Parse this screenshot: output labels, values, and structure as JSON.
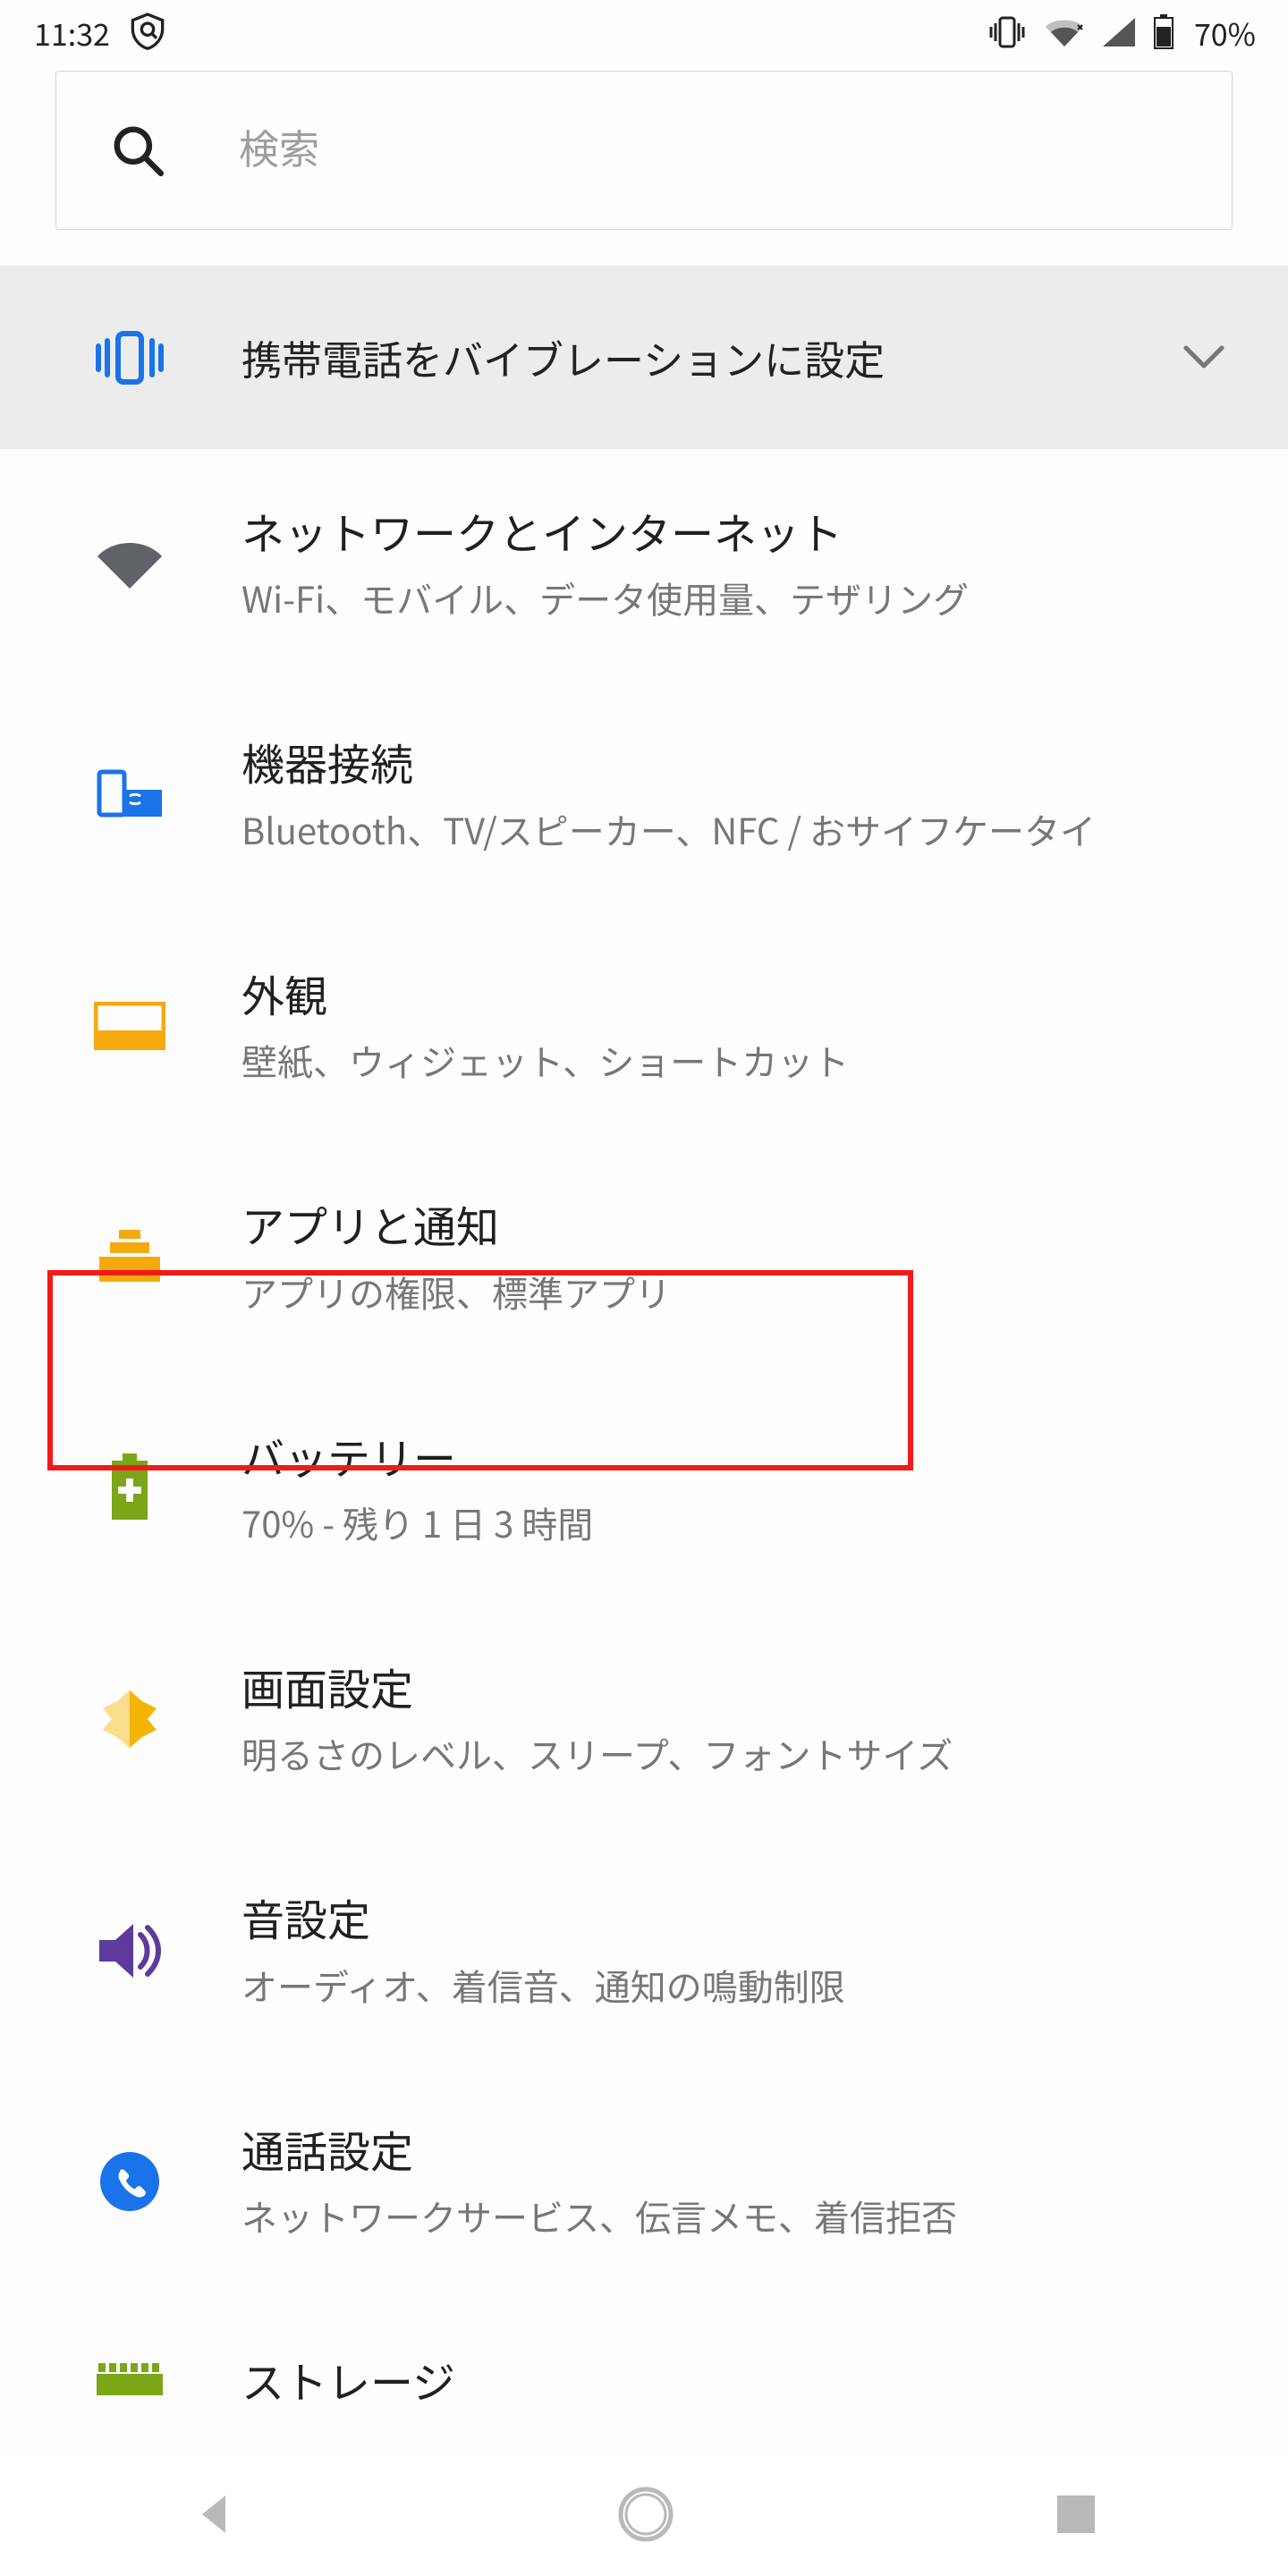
{
  "status": {
    "time": "11:32",
    "battery_pct": "70%"
  },
  "search": {
    "placeholder": "検索"
  },
  "suggestion": {
    "label": "携帯電話をバイブレーションに設定"
  },
  "settings_list": [
    {
      "title": "ネットワークとインターネット",
      "subtitle": "Wi‑Fi、モバイル、データ使用量、テザリング",
      "icon": "wifi"
    },
    {
      "title": "機器接続",
      "subtitle": "Bluetooth、TV/スピーカー、NFC / おサイフケータイ",
      "icon": "connected"
    },
    {
      "title": "外観",
      "subtitle": "壁紙、ウィジェット、ショートカット",
      "icon": "appearance"
    },
    {
      "title": "アプリと通知",
      "subtitle": "アプリの権限、標準アプリ",
      "icon": "apps"
    },
    {
      "title": "バッテリー",
      "subtitle": "70% - 残り 1 日 3 時間",
      "icon": "battery"
    },
    {
      "title": "画面設定",
      "subtitle": "明るさのレベル、スリープ、フォントサイズ",
      "icon": "display"
    },
    {
      "title": "音設定",
      "subtitle": "オーディオ、着信音、通知の鳴動制限",
      "icon": "sound"
    },
    {
      "title": "通話設定",
      "subtitle": "ネットワークサービス、伝言メモ、着信拒否",
      "icon": "call"
    },
    {
      "title": "ストレージ",
      "subtitle": "",
      "icon": "storage"
    }
  ],
  "colors": {
    "accent_blue": "#1a73e8",
    "icon_orange": "#f4a90e",
    "icon_green": "#7aa617",
    "icon_yellow": "#f4b400",
    "icon_purple": "#5d3a9b",
    "icon_blue_solid": "#1a73e8"
  }
}
